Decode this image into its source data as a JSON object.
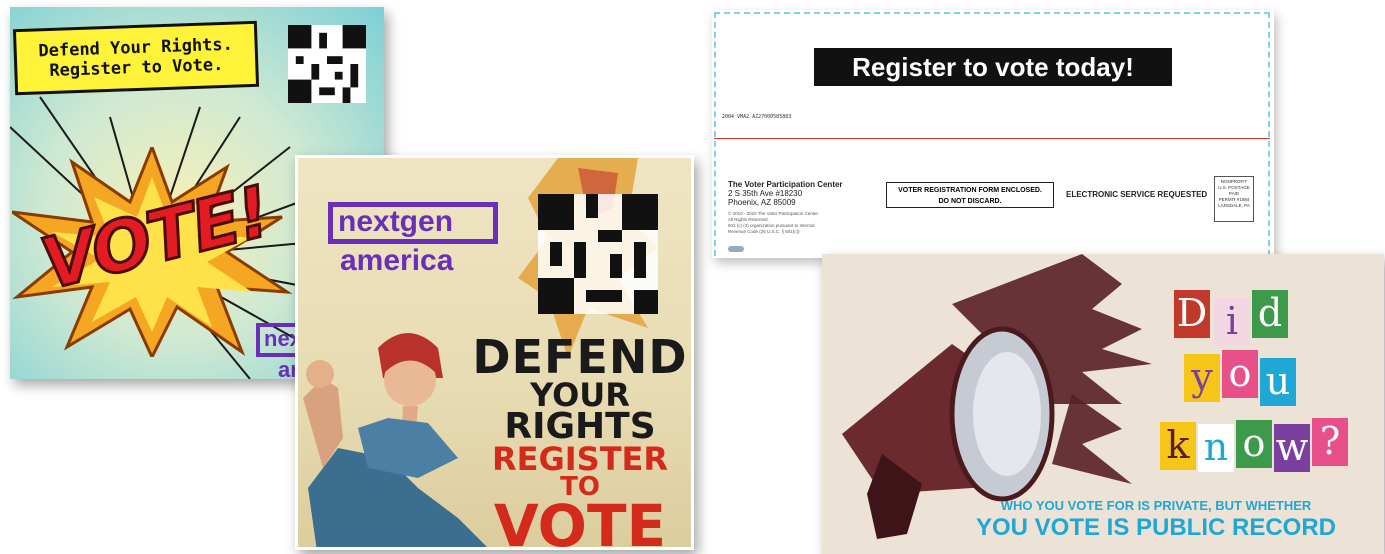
{
  "card1": {
    "banner": "Defend Your Rights.\nRegister to Vote.",
    "headline": "VOTE!",
    "logo_line1": "nex",
    "logo_line2": "am"
  },
  "card2": {
    "logo_line1": "nextgen",
    "logo_line2": "america",
    "stack": [
      "DEFEND",
      "YOUR",
      "RIGHTS",
      "REGISTER",
      "TO",
      "VOTE"
    ]
  },
  "card3": {
    "headline": "Register to vote today!",
    "barcode": "2004  VMA2  AZ27000585883",
    "org_name": "The Voter Participation Center",
    "org_addr1": "2 S 35th Ave #18230",
    "org_addr2": "Phoenix, AZ 85009",
    "copyright": "© 2010 - 2022 The Voter Participation Center.",
    "rights": "All Rights Reserved.",
    "tax1": "501 (c) (3) organization pursuant to Internal",
    "tax2": "Revenue Code (26 U.S.C. § 501(c))",
    "enclosed": "VOTER REGISTRATION FORM ENCLOSED.\nDO NOT DISCARD.",
    "service": "ELECTRONIC SERVICE REQUESTED",
    "postage": "NONPROFIT\nU.S. POSTAGE\nPAID\nPERMIT #1984\nLANSDALE, PA"
  },
  "card4": {
    "letters": [
      "D",
      "i",
      "d",
      "y",
      "o",
      "u",
      "k",
      "n",
      "o",
      "w",
      "?"
    ],
    "colors": {
      "blue": "#1fa7d6",
      "red": "#c0392b",
      "purple": "#7b3fa0",
      "green": "#3c9a4a",
      "yellow": "#f5c518",
      "pink": "#e8508a"
    },
    "sub1": "WHO YOU VOTE FOR IS PRIVATE, BUT WHETHER",
    "sub2": "YOU VOTE IS PUBLIC RECORD"
  }
}
